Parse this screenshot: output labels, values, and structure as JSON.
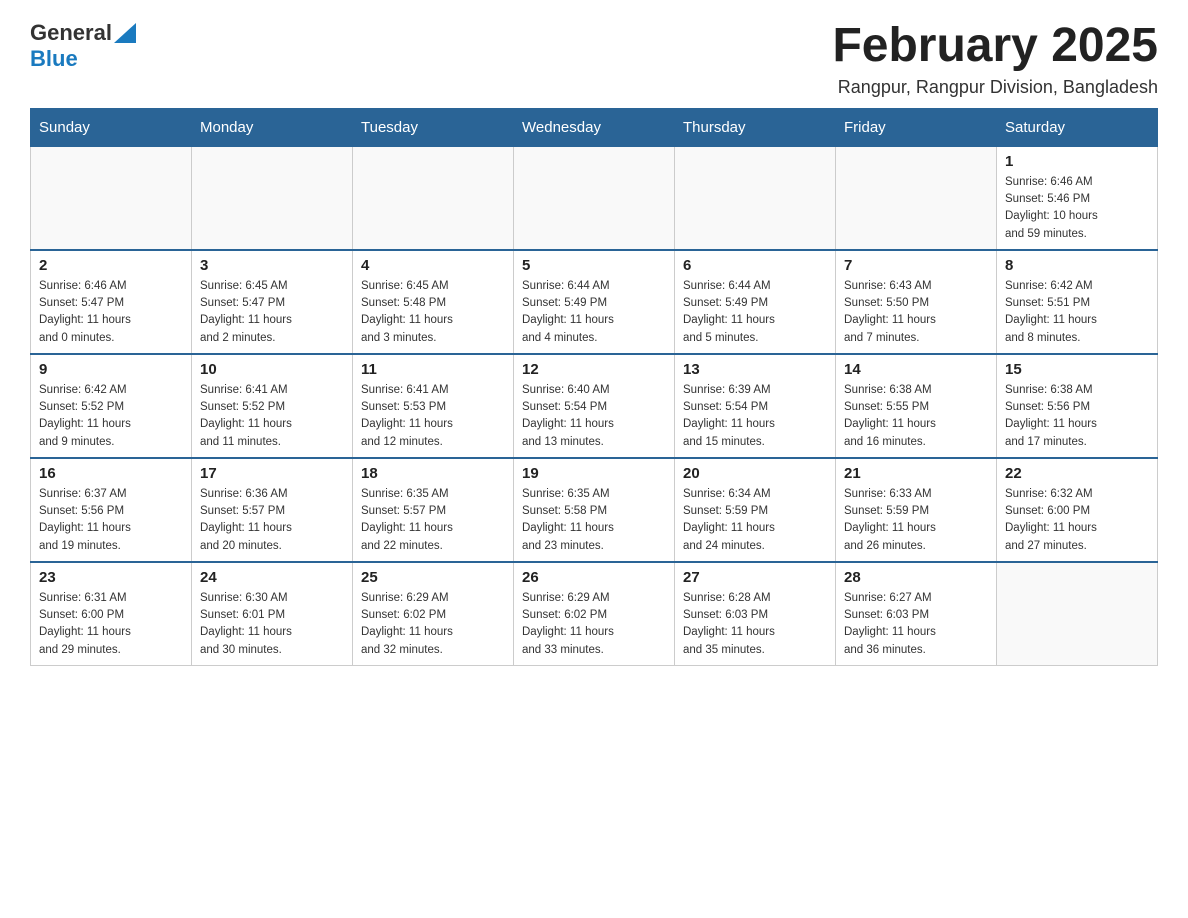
{
  "header": {
    "logo_general": "General",
    "logo_blue": "Blue",
    "title": "February 2025",
    "subtitle": "Rangpur, Rangpur Division, Bangladesh"
  },
  "weekdays": [
    "Sunday",
    "Monday",
    "Tuesday",
    "Wednesday",
    "Thursday",
    "Friday",
    "Saturday"
  ],
  "weeks": [
    [
      {
        "day": "",
        "info": ""
      },
      {
        "day": "",
        "info": ""
      },
      {
        "day": "",
        "info": ""
      },
      {
        "day": "",
        "info": ""
      },
      {
        "day": "",
        "info": ""
      },
      {
        "day": "",
        "info": ""
      },
      {
        "day": "1",
        "info": "Sunrise: 6:46 AM\nSunset: 5:46 PM\nDaylight: 10 hours\nand 59 minutes."
      }
    ],
    [
      {
        "day": "2",
        "info": "Sunrise: 6:46 AM\nSunset: 5:47 PM\nDaylight: 11 hours\nand 0 minutes."
      },
      {
        "day": "3",
        "info": "Sunrise: 6:45 AM\nSunset: 5:47 PM\nDaylight: 11 hours\nand 2 minutes."
      },
      {
        "day": "4",
        "info": "Sunrise: 6:45 AM\nSunset: 5:48 PM\nDaylight: 11 hours\nand 3 minutes."
      },
      {
        "day": "5",
        "info": "Sunrise: 6:44 AM\nSunset: 5:49 PM\nDaylight: 11 hours\nand 4 minutes."
      },
      {
        "day": "6",
        "info": "Sunrise: 6:44 AM\nSunset: 5:49 PM\nDaylight: 11 hours\nand 5 minutes."
      },
      {
        "day": "7",
        "info": "Sunrise: 6:43 AM\nSunset: 5:50 PM\nDaylight: 11 hours\nand 7 minutes."
      },
      {
        "day": "8",
        "info": "Sunrise: 6:42 AM\nSunset: 5:51 PM\nDaylight: 11 hours\nand 8 minutes."
      }
    ],
    [
      {
        "day": "9",
        "info": "Sunrise: 6:42 AM\nSunset: 5:52 PM\nDaylight: 11 hours\nand 9 minutes."
      },
      {
        "day": "10",
        "info": "Sunrise: 6:41 AM\nSunset: 5:52 PM\nDaylight: 11 hours\nand 11 minutes."
      },
      {
        "day": "11",
        "info": "Sunrise: 6:41 AM\nSunset: 5:53 PM\nDaylight: 11 hours\nand 12 minutes."
      },
      {
        "day": "12",
        "info": "Sunrise: 6:40 AM\nSunset: 5:54 PM\nDaylight: 11 hours\nand 13 minutes."
      },
      {
        "day": "13",
        "info": "Sunrise: 6:39 AM\nSunset: 5:54 PM\nDaylight: 11 hours\nand 15 minutes."
      },
      {
        "day": "14",
        "info": "Sunrise: 6:38 AM\nSunset: 5:55 PM\nDaylight: 11 hours\nand 16 minutes."
      },
      {
        "day": "15",
        "info": "Sunrise: 6:38 AM\nSunset: 5:56 PM\nDaylight: 11 hours\nand 17 minutes."
      }
    ],
    [
      {
        "day": "16",
        "info": "Sunrise: 6:37 AM\nSunset: 5:56 PM\nDaylight: 11 hours\nand 19 minutes."
      },
      {
        "day": "17",
        "info": "Sunrise: 6:36 AM\nSunset: 5:57 PM\nDaylight: 11 hours\nand 20 minutes."
      },
      {
        "day": "18",
        "info": "Sunrise: 6:35 AM\nSunset: 5:57 PM\nDaylight: 11 hours\nand 22 minutes."
      },
      {
        "day": "19",
        "info": "Sunrise: 6:35 AM\nSunset: 5:58 PM\nDaylight: 11 hours\nand 23 minutes."
      },
      {
        "day": "20",
        "info": "Sunrise: 6:34 AM\nSunset: 5:59 PM\nDaylight: 11 hours\nand 24 minutes."
      },
      {
        "day": "21",
        "info": "Sunrise: 6:33 AM\nSunset: 5:59 PM\nDaylight: 11 hours\nand 26 minutes."
      },
      {
        "day": "22",
        "info": "Sunrise: 6:32 AM\nSunset: 6:00 PM\nDaylight: 11 hours\nand 27 minutes."
      }
    ],
    [
      {
        "day": "23",
        "info": "Sunrise: 6:31 AM\nSunset: 6:00 PM\nDaylight: 11 hours\nand 29 minutes."
      },
      {
        "day": "24",
        "info": "Sunrise: 6:30 AM\nSunset: 6:01 PM\nDaylight: 11 hours\nand 30 minutes."
      },
      {
        "day": "25",
        "info": "Sunrise: 6:29 AM\nSunset: 6:02 PM\nDaylight: 11 hours\nand 32 minutes."
      },
      {
        "day": "26",
        "info": "Sunrise: 6:29 AM\nSunset: 6:02 PM\nDaylight: 11 hours\nand 33 minutes."
      },
      {
        "day": "27",
        "info": "Sunrise: 6:28 AM\nSunset: 6:03 PM\nDaylight: 11 hours\nand 35 minutes."
      },
      {
        "day": "28",
        "info": "Sunrise: 6:27 AM\nSunset: 6:03 PM\nDaylight: 11 hours\nand 36 minutes."
      },
      {
        "day": "",
        "info": ""
      }
    ]
  ]
}
